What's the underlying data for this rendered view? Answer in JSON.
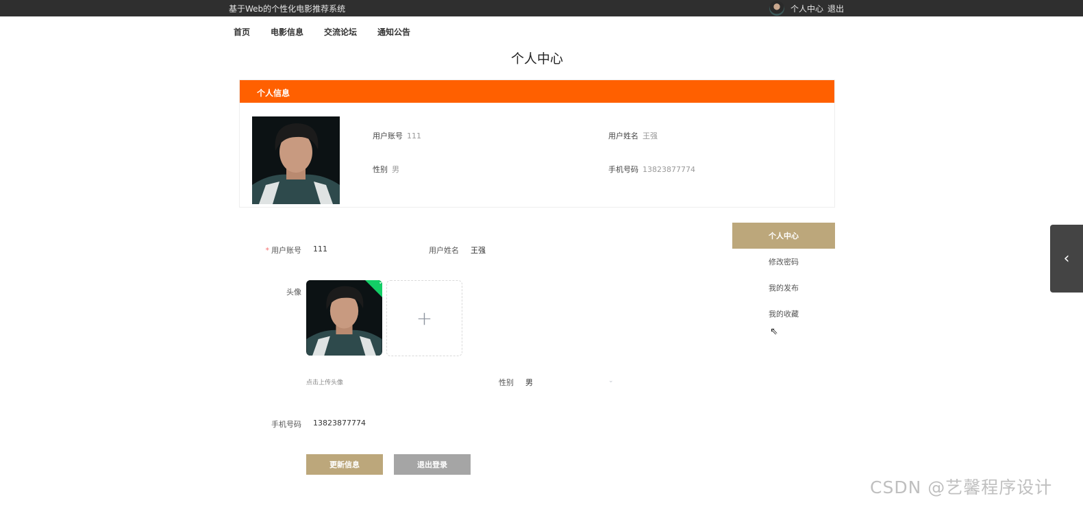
{
  "topbar": {
    "site_title": "基于Web的个性化电影推荐系统",
    "user_center": "个人中心",
    "logout": "退出"
  },
  "nav": {
    "items": [
      "首页",
      "电影信息",
      "交流论坛",
      "通知公告"
    ]
  },
  "page": {
    "title": "个人中心"
  },
  "info_card": {
    "header": "个人信息",
    "account_label": "用户账号",
    "account_value": "111",
    "name_label": "用户姓名",
    "name_value": "王强",
    "gender_label": "性别",
    "gender_value": "男",
    "phone_label": "手机号码",
    "phone_value": "13823877774"
  },
  "form": {
    "account_label": "用户账号",
    "account_value": "111",
    "name_label": "用户姓名",
    "name_value": "王强",
    "avatar_label": "头像",
    "upload_tip": "点击上传头像",
    "gender_label": "性别",
    "gender_value": "男",
    "phone_label": "手机号码",
    "phone_value": "13823877774",
    "update_button": "更新信息",
    "logout_button": "退出登录"
  },
  "side_menu": {
    "items": [
      "个人中心",
      "修改密码",
      "我的发布",
      "我的收藏"
    ],
    "active_index": 0
  },
  "watermark": "CSDN @艺馨程序设计",
  "colors": {
    "topbar": "#2f2f2f",
    "info_header": "#ff6000",
    "accent": "#bca77b",
    "logout_button": "#a5a5a5"
  }
}
